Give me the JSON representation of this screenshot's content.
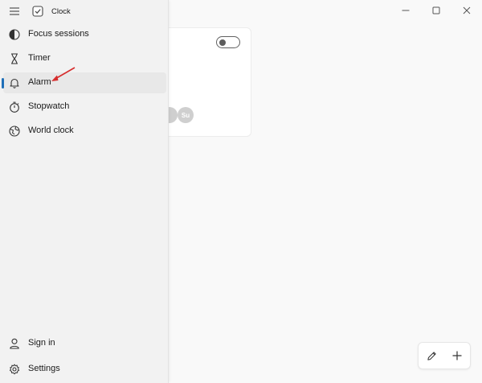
{
  "app": {
    "title": "Clock"
  },
  "window_controls": [
    "minimize-icon",
    "maximize-icon",
    "close-icon"
  ],
  "nav": {
    "items": [
      {
        "label": "Focus sessions",
        "icon": "focus-icon"
      },
      {
        "label": "Timer",
        "icon": "hourglass-icon"
      },
      {
        "label": "Alarm",
        "icon": "bell-icon",
        "selected": true
      },
      {
        "label": "Stopwatch",
        "icon": "stopwatch-icon"
      },
      {
        "label": "World clock",
        "icon": "globe-icon"
      }
    ],
    "footer": [
      {
        "label": "Sign in",
        "icon": "person-icon"
      },
      {
        "label": "Settings",
        "icon": "gear-icon"
      }
    ]
  },
  "alarm_card": {
    "toggle_on": false,
    "days_visible": [
      "Su"
    ]
  },
  "actions": {
    "edit_icon": "pencil-icon",
    "add_icon": "plus-icon"
  },
  "colors": {
    "accent": "#1f6fb8",
    "annotation_arrow": "#d62d2d",
    "nav_bg": "#f2f2f2"
  }
}
